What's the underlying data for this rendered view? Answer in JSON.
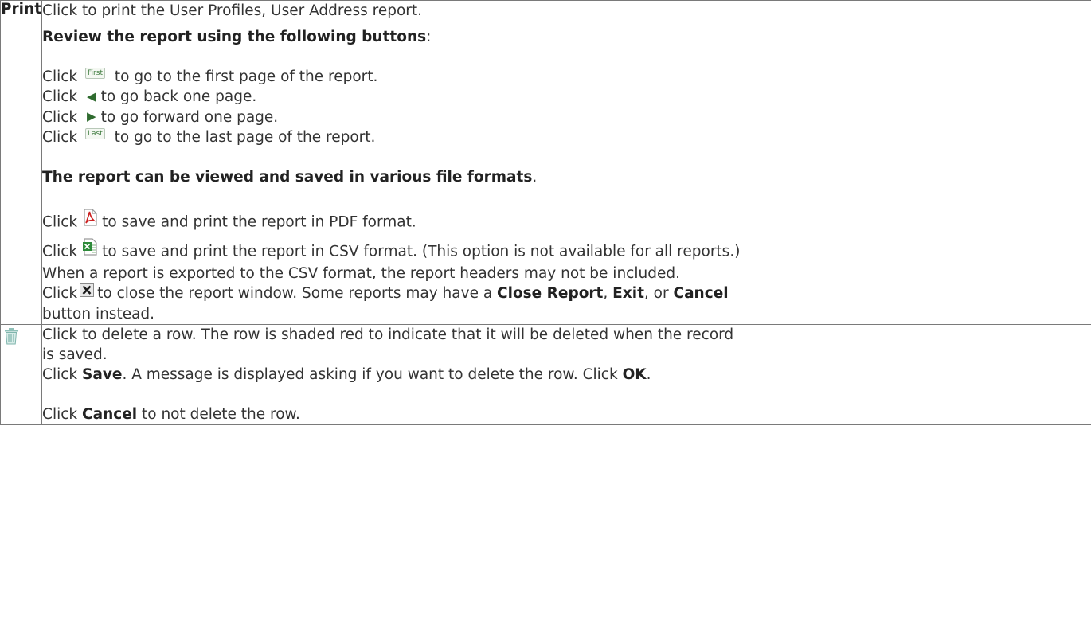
{
  "print_row": {
    "label": "Print",
    "intro": "Click to print the User Profiles, User Address report.",
    "review_heading_bold": "Review the report using the following buttons",
    "review_heading_tail": ":",
    "nav": [
      {
        "prefix": "Click",
        "icon": "first-button-icon",
        "button_text": "First",
        "suffix": " to go to the first page of the report."
      },
      {
        "prefix": "Click",
        "icon": "back-arrow-icon",
        "button_text": "◀",
        "suffix": "to go back one page."
      },
      {
        "prefix": "Click",
        "icon": "forward-arrow-icon",
        "button_text": "▶",
        "suffix": "to go forward one page."
      },
      {
        "prefix": "Click",
        "icon": "last-button-icon",
        "button_text": "Last",
        "suffix": " to go to the last page of the report."
      }
    ],
    "formats_heading_bold": "The report can be viewed and saved in various file formats",
    "formats_heading_tail": ".",
    "pdf": {
      "prefix": "Click",
      "icon": "pdf-icon",
      "suffix": "to save and print the report in PDF format."
    },
    "csv": {
      "prefix": "Click",
      "icon": "csv-excel-icon",
      "suffix": "to save and print the report in CSV format. (This option is not available for all reports.)"
    },
    "csv_note": "When a report is exported to the CSV format, the report headers may not be included.",
    "close": {
      "prefix": "Click",
      "icon": "close-report-icon",
      "suffix": "to close the report window. Some reports may have a ",
      "btn1": "Close Report",
      "sep1": ", ",
      "btn2": "Exit",
      "sep2": ", or ",
      "btn3": "Cancel",
      "line2": "button instead."
    }
  },
  "delete_row": {
    "icon": "trash-icon",
    "line1": "Click to delete a row. The row is shaded red to indicate that it will be deleted when the record",
    "line2": "is saved.",
    "save_prefix": "Click ",
    "save_bold": "Save",
    "save_mid": ". A message is displayed asking if you want to delete the row. Click ",
    "ok_bold": "OK",
    "save_end": ".",
    "cancel_prefix": "Click ",
    "cancel_bold": "Cancel",
    "cancel_suffix": " to not delete the row."
  },
  "colors": {
    "border": "#7a7a7a",
    "text": "#333333",
    "nav_green": "#2f6b2f",
    "pdf_red": "#cc2222",
    "excel_green": "#2e8b3a",
    "trash_teal": "#7fb5ad"
  }
}
